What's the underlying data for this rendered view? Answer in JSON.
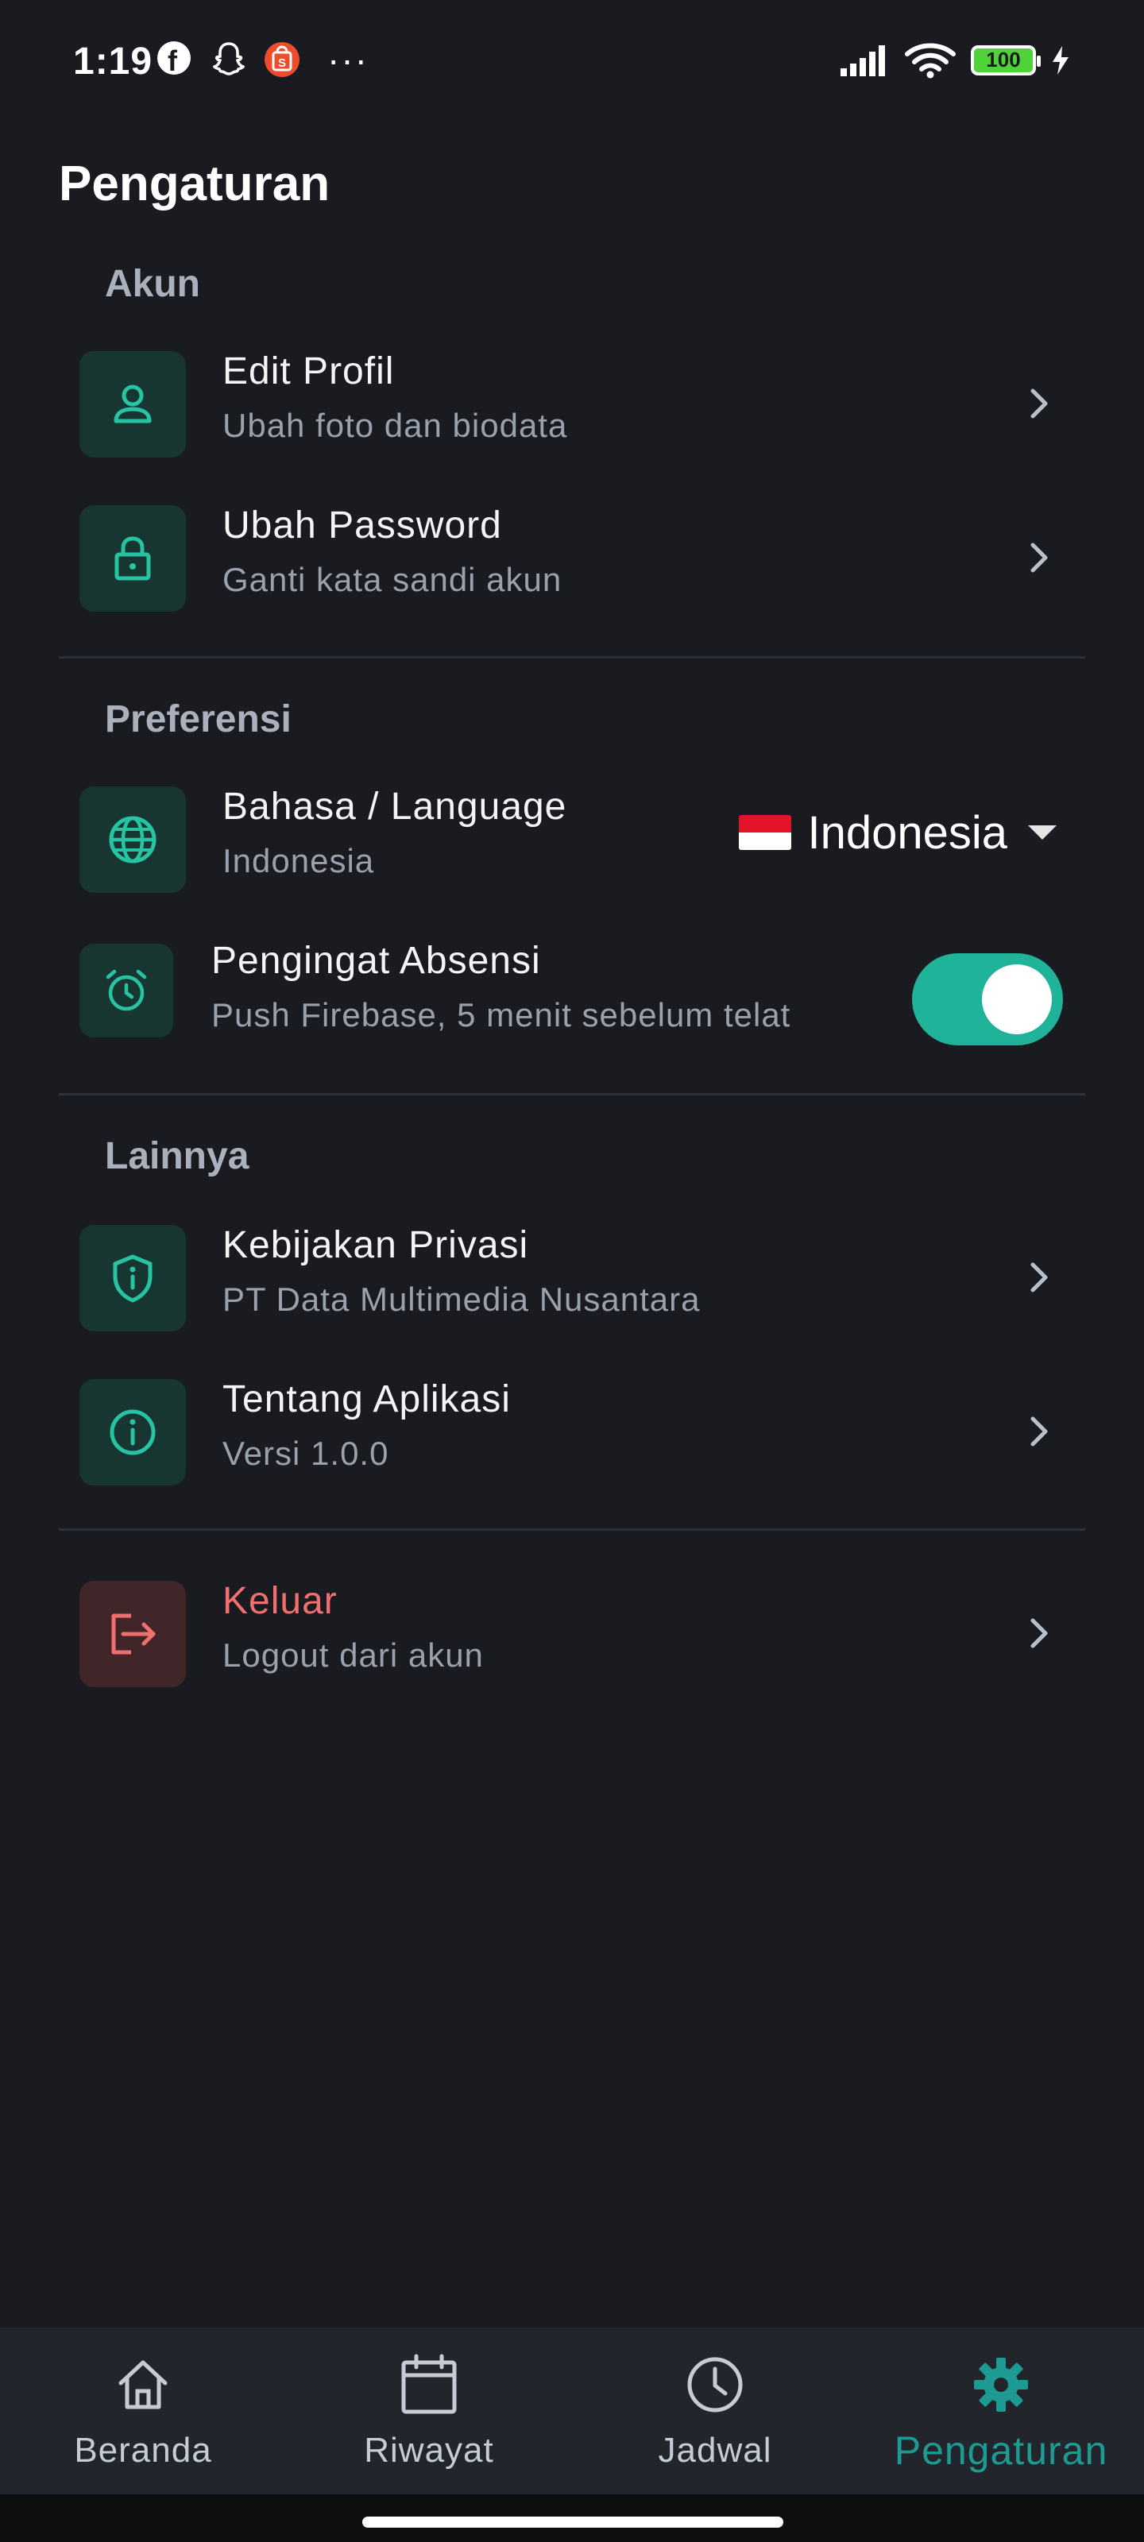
{
  "status_bar": {
    "time": "1:19",
    "battery": "100",
    "icons": [
      "facebook-icon",
      "snapchat-icon",
      "shopee-icon",
      "more-dots-icon",
      "signal-icon",
      "wifi-icon",
      "battery-icon",
      "charging-icon"
    ],
    "dots": "···"
  },
  "page": {
    "title": "Pengaturan"
  },
  "sections": {
    "akun": {
      "heading": "Akun",
      "items": [
        {
          "label": "Edit Profil",
          "sub": "Ubah foto dan biodata",
          "icon": "person-icon"
        },
        {
          "label": "Ubah Password",
          "sub": "Ganti kata sandi akun",
          "icon": "lock-icon"
        }
      ]
    },
    "preferensi": {
      "heading": "Preferensi",
      "language": {
        "label": "Bahasa / Language",
        "sub": "Indonesia",
        "selected": "Indonesia",
        "icon": "globe-icon"
      },
      "reminder": {
        "label": "Pengingat Absensi",
        "sub": "Push Firebase, 5 menit sebelum telat",
        "enabled": true,
        "icon": "alarm-icon"
      }
    },
    "lainnya": {
      "heading": "Lainnya",
      "items": [
        {
          "label": "Kebijakan Privasi",
          "sub": "PT Data Multimedia Nusantara",
          "icon": "shield-info-icon"
        },
        {
          "label": "Tentang Aplikasi",
          "sub": "Versi 1.0.0",
          "icon": "info-icon"
        }
      ]
    },
    "logout": {
      "label": "Keluar",
      "sub": "Logout dari akun",
      "icon": "logout-icon"
    }
  },
  "bottom_nav": {
    "items": [
      {
        "label": "Beranda",
        "icon": "home-icon"
      },
      {
        "label": "Riwayat",
        "icon": "calendar-icon"
      },
      {
        "label": "Jadwal",
        "icon": "clock-icon"
      },
      {
        "label": "Pengaturan",
        "icon": "gear-icon",
        "active": true
      }
    ]
  },
  "colors": {
    "background": "#1a1b20",
    "accent": "#1fb39a",
    "icon_teal": "#27c4a4",
    "danger": "#f07070",
    "nav_active": "#1d9b93"
  }
}
